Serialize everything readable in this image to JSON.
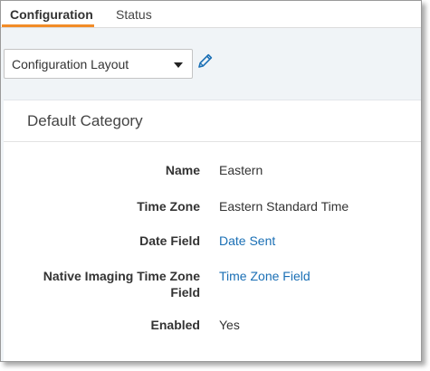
{
  "tabs": [
    {
      "label": "Configuration",
      "active": true
    },
    {
      "label": "Status",
      "active": false
    }
  ],
  "layout_select": {
    "value": "Configuration Layout"
  },
  "colors": {
    "accent": "#f28c28",
    "link": "#1a6fb5",
    "edit_icon": "#1a6fb5"
  },
  "icons": {
    "edit": "pencil-icon",
    "dropdown": "caret-down-icon"
  },
  "category": {
    "title": "Default Category",
    "fields": [
      {
        "label": "Name",
        "value": "Eastern",
        "link": false
      },
      {
        "label": "Time Zone",
        "value": "Eastern Standard Time",
        "link": false
      },
      {
        "label": "Date Field",
        "value": "Date Sent",
        "link": true
      },
      {
        "label": "Native Imaging Time Zone Field",
        "value": "Time Zone Field",
        "link": true
      },
      {
        "label": "Enabled",
        "value": "Yes",
        "link": false
      }
    ]
  }
}
